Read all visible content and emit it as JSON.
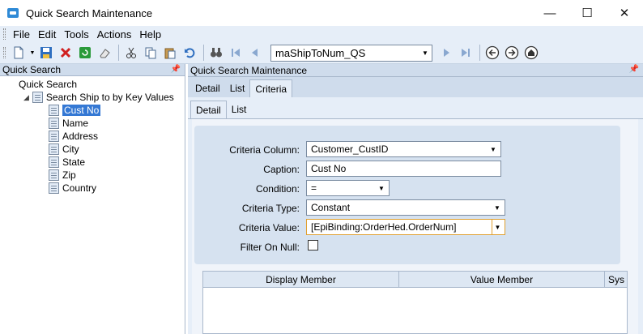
{
  "window": {
    "title": "Quick Search Maintenance",
    "controls": {
      "minimize": "—",
      "maximize": "☐",
      "close": "✕"
    }
  },
  "menu": [
    "File",
    "Edit",
    "Tools",
    "Actions",
    "Help"
  ],
  "toolbar": {
    "icons": [
      "new-icon",
      "save-icon",
      "delete-icon",
      "refresh-icon",
      "clear-icon",
      "cut-icon",
      "copy-icon",
      "paste-icon",
      "undo-icon",
      "find-icon",
      "first-icon",
      "prev-icon",
      "next-icon",
      "last-icon",
      "back-icon",
      "forward-icon",
      "home-icon"
    ],
    "combo_value": "maShipToNum_QS"
  },
  "left_panel": {
    "title": "Quick Search",
    "tree": {
      "root": "Quick Search",
      "child": "Search Ship to by Key Values",
      "items": [
        "Cust No",
        "Name",
        "Address",
        "City",
        "State",
        "Zip",
        "Country"
      ],
      "selected": "Cust No"
    }
  },
  "right_panel": {
    "title": "Quick Search Maintenance",
    "tabs": [
      "Detail",
      "List",
      "Criteria"
    ],
    "active_tab": "Criteria",
    "subtabs": [
      "Detail",
      "List"
    ],
    "active_subtab": "Detail",
    "form": {
      "criteria_column": {
        "label": "Criteria Column:",
        "value": "Customer_CustID"
      },
      "caption": {
        "label": "Caption:",
        "value": "Cust No"
      },
      "condition": {
        "label": "Condition:",
        "value": "="
      },
      "criteria_type": {
        "label": "Criteria Type:",
        "value": "Constant"
      },
      "criteria_value": {
        "label": "Criteria Value:",
        "value": "[EpiBinding:OrderHed.OrderNum]"
      },
      "filter_on_null": {
        "label": "Filter On Null:",
        "checked": false
      }
    },
    "grid": {
      "columns": [
        "Display Member",
        "Value Member",
        "Sys"
      ]
    }
  }
}
